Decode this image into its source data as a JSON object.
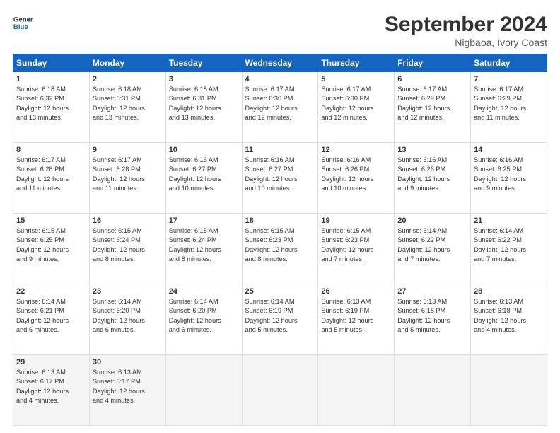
{
  "logo": {
    "line1": "General",
    "line2": "Blue"
  },
  "title": "September 2024",
  "location": "Nigbaoa, Ivory Coast",
  "headers": [
    "Sunday",
    "Monday",
    "Tuesday",
    "Wednesday",
    "Thursday",
    "Friday",
    "Saturday"
  ],
  "weeks": [
    [
      {
        "day": "1",
        "info": "Sunrise: 6:18 AM\nSunset: 6:32 PM\nDaylight: 12 hours\nand 13 minutes."
      },
      {
        "day": "2",
        "info": "Sunrise: 6:18 AM\nSunset: 6:31 PM\nDaylight: 12 hours\nand 13 minutes."
      },
      {
        "day": "3",
        "info": "Sunrise: 6:18 AM\nSunset: 6:31 PM\nDaylight: 12 hours\nand 13 minutes."
      },
      {
        "day": "4",
        "info": "Sunrise: 6:17 AM\nSunset: 6:30 PM\nDaylight: 12 hours\nand 12 minutes."
      },
      {
        "day": "5",
        "info": "Sunrise: 6:17 AM\nSunset: 6:30 PM\nDaylight: 12 hours\nand 12 minutes."
      },
      {
        "day": "6",
        "info": "Sunrise: 6:17 AM\nSunset: 6:29 PM\nDaylight: 12 hours\nand 12 minutes."
      },
      {
        "day": "7",
        "info": "Sunrise: 6:17 AM\nSunset: 6:29 PM\nDaylight: 12 hours\nand 11 minutes."
      }
    ],
    [
      {
        "day": "8",
        "info": "Sunrise: 6:17 AM\nSunset: 6:28 PM\nDaylight: 12 hours\nand 11 minutes."
      },
      {
        "day": "9",
        "info": "Sunrise: 6:17 AM\nSunset: 6:28 PM\nDaylight: 12 hours\nand 11 minutes."
      },
      {
        "day": "10",
        "info": "Sunrise: 6:16 AM\nSunset: 6:27 PM\nDaylight: 12 hours\nand 10 minutes."
      },
      {
        "day": "11",
        "info": "Sunrise: 6:16 AM\nSunset: 6:27 PM\nDaylight: 12 hours\nand 10 minutes."
      },
      {
        "day": "12",
        "info": "Sunrise: 6:16 AM\nSunset: 6:26 PM\nDaylight: 12 hours\nand 10 minutes."
      },
      {
        "day": "13",
        "info": "Sunrise: 6:16 AM\nSunset: 6:26 PM\nDaylight: 12 hours\nand 9 minutes."
      },
      {
        "day": "14",
        "info": "Sunrise: 6:16 AM\nSunset: 6:25 PM\nDaylight: 12 hours\nand 9 minutes."
      }
    ],
    [
      {
        "day": "15",
        "info": "Sunrise: 6:15 AM\nSunset: 6:25 PM\nDaylight: 12 hours\nand 9 minutes."
      },
      {
        "day": "16",
        "info": "Sunrise: 6:15 AM\nSunset: 6:24 PM\nDaylight: 12 hours\nand 8 minutes."
      },
      {
        "day": "17",
        "info": "Sunrise: 6:15 AM\nSunset: 6:24 PM\nDaylight: 12 hours\nand 8 minutes."
      },
      {
        "day": "18",
        "info": "Sunrise: 6:15 AM\nSunset: 6:23 PM\nDaylight: 12 hours\nand 8 minutes."
      },
      {
        "day": "19",
        "info": "Sunrise: 6:15 AM\nSunset: 6:23 PM\nDaylight: 12 hours\nand 7 minutes."
      },
      {
        "day": "20",
        "info": "Sunrise: 6:14 AM\nSunset: 6:22 PM\nDaylight: 12 hours\nand 7 minutes."
      },
      {
        "day": "21",
        "info": "Sunrise: 6:14 AM\nSunset: 6:22 PM\nDaylight: 12 hours\nand 7 minutes."
      }
    ],
    [
      {
        "day": "22",
        "info": "Sunrise: 6:14 AM\nSunset: 6:21 PM\nDaylight: 12 hours\nand 6 minutes."
      },
      {
        "day": "23",
        "info": "Sunrise: 6:14 AM\nSunset: 6:20 PM\nDaylight: 12 hours\nand 6 minutes."
      },
      {
        "day": "24",
        "info": "Sunrise: 6:14 AM\nSunset: 6:20 PM\nDaylight: 12 hours\nand 6 minutes."
      },
      {
        "day": "25",
        "info": "Sunrise: 6:14 AM\nSunset: 6:19 PM\nDaylight: 12 hours\nand 5 minutes."
      },
      {
        "day": "26",
        "info": "Sunrise: 6:13 AM\nSunset: 6:19 PM\nDaylight: 12 hours\nand 5 minutes."
      },
      {
        "day": "27",
        "info": "Sunrise: 6:13 AM\nSunset: 6:18 PM\nDaylight: 12 hours\nand 5 minutes."
      },
      {
        "day": "28",
        "info": "Sunrise: 6:13 AM\nSunset: 6:18 PM\nDaylight: 12 hours\nand 4 minutes."
      }
    ],
    [
      {
        "day": "29",
        "info": "Sunrise: 6:13 AM\nSunset: 6:17 PM\nDaylight: 12 hours\nand 4 minutes."
      },
      {
        "day": "30",
        "info": "Sunrise: 6:13 AM\nSunset: 6:17 PM\nDaylight: 12 hours\nand 4 minutes."
      },
      {
        "day": "",
        "info": ""
      },
      {
        "day": "",
        "info": ""
      },
      {
        "day": "",
        "info": ""
      },
      {
        "day": "",
        "info": ""
      },
      {
        "day": "",
        "info": ""
      }
    ]
  ]
}
